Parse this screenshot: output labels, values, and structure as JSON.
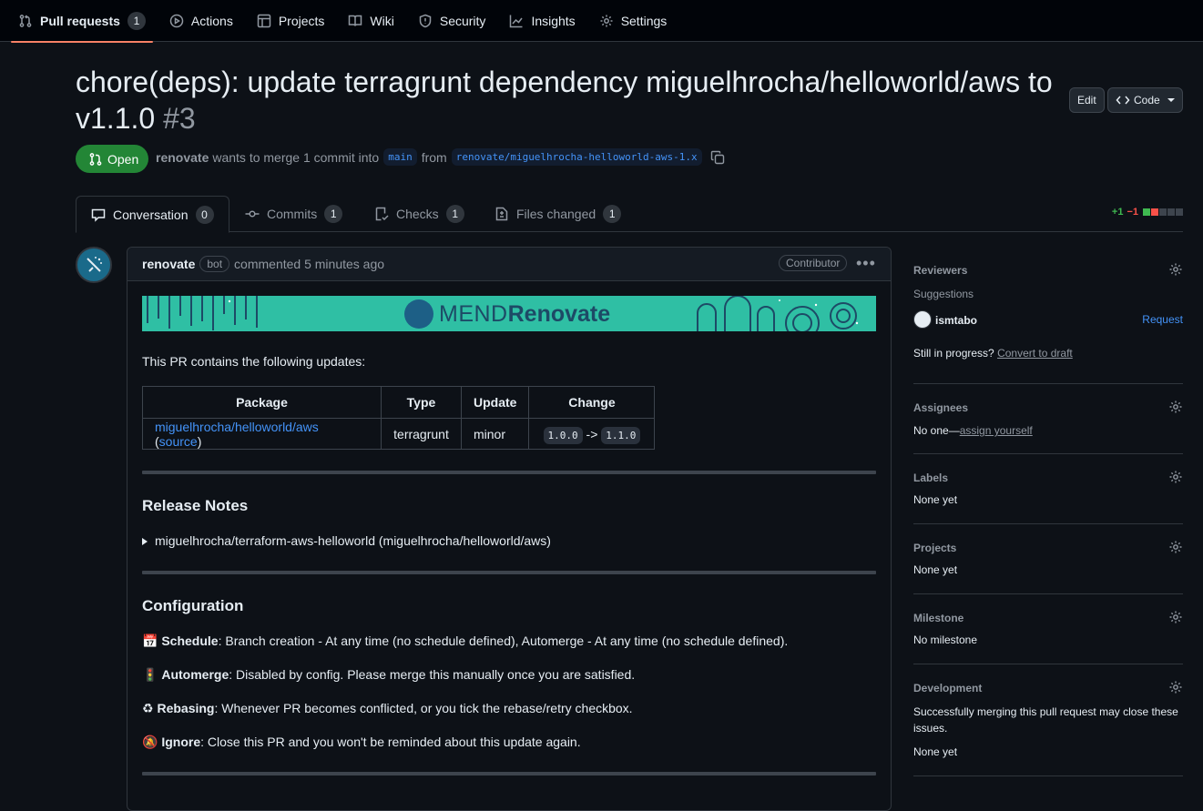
{
  "nav": {
    "items": [
      {
        "label": "Pull requests",
        "count": "1"
      },
      {
        "label": "Actions"
      },
      {
        "label": "Projects"
      },
      {
        "label": "Wiki"
      },
      {
        "label": "Security"
      },
      {
        "label": "Insights"
      },
      {
        "label": "Settings"
      }
    ]
  },
  "pr": {
    "title": "chore(deps): update terragrunt dependency miguelhrocha/helloworld/aws to v1.1.0",
    "number": "#3",
    "edit_label": "Edit",
    "code_label": "Code",
    "state": "Open",
    "author": "renovate",
    "merge_text": "wants to merge 1 commit into",
    "base_branch": "main",
    "from_text": "from",
    "head_branch": "renovate/miguelhrocha-helloworld-aws-1.x"
  },
  "tabs": [
    {
      "label": "Conversation",
      "count": "0"
    },
    {
      "label": "Commits",
      "count": "1"
    },
    {
      "label": "Checks",
      "count": "1"
    },
    {
      "label": "Files changed",
      "count": "1"
    }
  ],
  "diffstat": {
    "added": "+1",
    "removed": "−1",
    "colors": [
      "#3fb950",
      "#f85149",
      "#3d444d",
      "#3d444d",
      "#3d444d"
    ]
  },
  "comment": {
    "author": "renovate",
    "badge": "bot",
    "when": "commented 5 minutes ago",
    "role": "Contributor",
    "banner": {
      "mend": "MEND",
      "renovate": "Renovate"
    },
    "intro": "This PR contains the following updates:",
    "table": {
      "headers": [
        "Package",
        "Type",
        "Update",
        "Change"
      ],
      "row": {
        "package": "miguelhrocha/helloworld/aws",
        "source": "source",
        "type": "terragrunt",
        "update": "minor",
        "from": "1.0.0",
        "arrow": "->",
        "to": "1.1.0"
      }
    },
    "release_notes_title": "Release Notes",
    "release_notes_item": "miguelhrocha/terraform-aws-helloworld (miguelhrocha/helloworld/aws)",
    "configuration_title": "Configuration",
    "config": [
      {
        "emoji": "📅",
        "key": "Schedule",
        "text": ": Branch creation - At any time (no schedule defined), Automerge - At any time (no schedule defined)."
      },
      {
        "emoji": "🚦",
        "key": "Automerge",
        "text": ": Disabled by config. Please merge this manually once you are satisfied."
      },
      {
        "emoji": "♻",
        "key": "Rebasing",
        "text": ": Whenever PR becomes conflicted, or you tick the rebase/retry checkbox."
      },
      {
        "emoji": "🔕",
        "key": "Ignore",
        "text": ": Close this PR and you won't be reminded about this update again."
      }
    ]
  },
  "sidebar": {
    "reviewers": {
      "title": "Reviewers",
      "suggestions": "Suggestions",
      "user": "ismtabo",
      "request": "Request",
      "draft_prefix": "Still in progress?",
      "draft_link": "Convert to draft"
    },
    "assignees": {
      "title": "Assignees",
      "text": "No one—",
      "link": "assign yourself"
    },
    "labels": {
      "title": "Labels",
      "text": "None yet"
    },
    "projects": {
      "title": "Projects",
      "text": "None yet"
    },
    "milestone": {
      "title": "Milestone",
      "text": "No milestone"
    },
    "development": {
      "title": "Development",
      "text": "Successfully merging this pull request may close these issues.",
      "text2": "None yet"
    }
  }
}
